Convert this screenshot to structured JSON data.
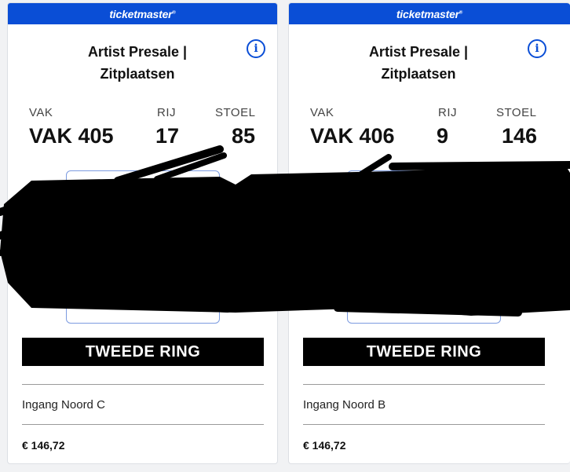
{
  "tickets": [
    {
      "brand": "ticketmaster",
      "title_line1": "Artist Presale |",
      "title_line2": "Zitplaatsen",
      "section_label": "VAK",
      "row_label": "RIJ",
      "seat_label": "STOEL",
      "section": "VAK 405",
      "row": "17",
      "seat": "85",
      "ring": "TWEEDE RING",
      "entrance": "Ingang Noord C",
      "price": "€ 146,72"
    },
    {
      "brand": "ticketmaster",
      "title_line1": "Artist Presale |",
      "title_line2": "Zitplaatsen",
      "section_label": "VAK",
      "row_label": "RIJ",
      "seat_label": "STOEL",
      "section": "VAK 406",
      "row": "9",
      "seat": "146",
      "ring": "TWEEDE RING",
      "entrance": "Ingang Noord B",
      "price": "€ 146,72"
    }
  ],
  "icons": {
    "info": "info-circle-icon",
    "redaction": "black-scribble-redaction"
  },
  "colors": {
    "brand_blue": "#0a4ed6",
    "ring_bg": "#000000",
    "background": "#f1f2f4"
  }
}
